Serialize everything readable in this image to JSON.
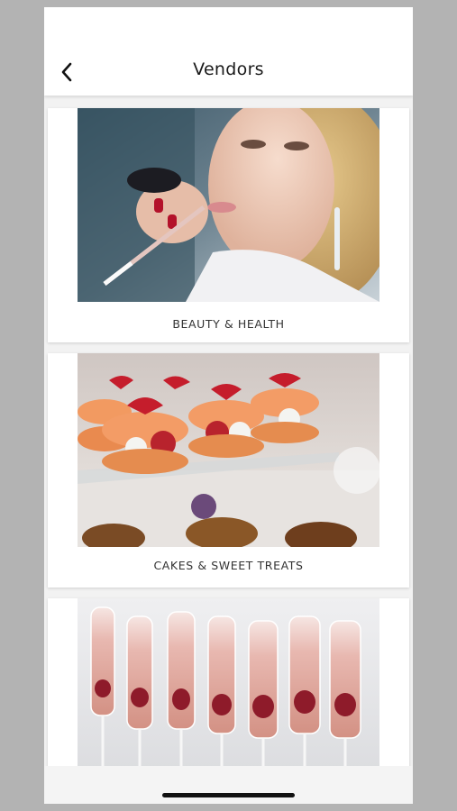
{
  "header": {
    "title": "Vendors",
    "back_icon": "chevron-left-icon"
  },
  "vendors": [
    {
      "label": "BEAUTY & HEALTH",
      "image": "bride-makeup-photo"
    },
    {
      "label": "CAKES & SWEET TREATS",
      "image": "macarons-dessert-photo"
    },
    {
      "label": "",
      "image": "champagne-glasses-photo"
    }
  ],
  "colors": {
    "background": "#b3b3b3",
    "header": "#ffffff",
    "list_background": "#f2f2f2",
    "text": "#1a1a1a"
  }
}
